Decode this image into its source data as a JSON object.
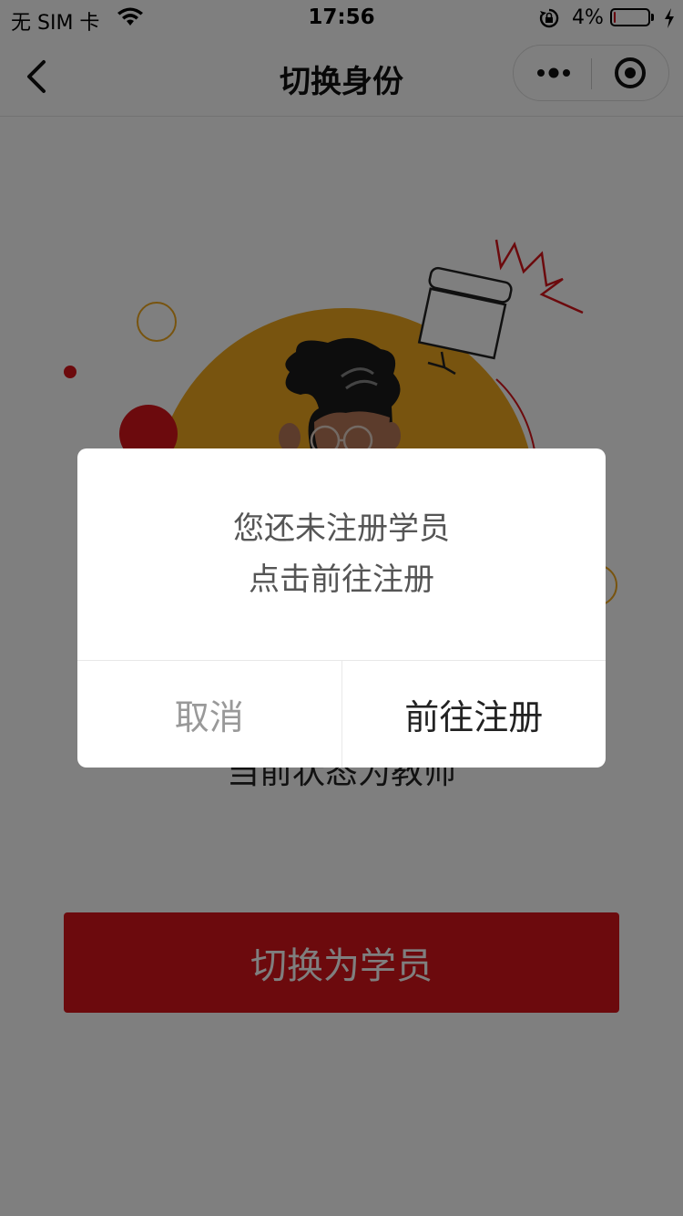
{
  "status_bar": {
    "carrier": "无 SIM 卡",
    "time": "17:56",
    "battery_percent": "4%",
    "battery_level": 0.04,
    "icons": [
      "wifi-icon",
      "orientation-lock-icon",
      "battery-icon",
      "charging-icon"
    ]
  },
  "nav": {
    "title": "切换身份",
    "back_icon": "chevron-left-icon",
    "more_icon": "more-dots-icon",
    "home_icon": "target-icon"
  },
  "main": {
    "status_text": "当前状态为教师",
    "switch_button_label": "切换为学员"
  },
  "modal": {
    "line1": "您还未注册学员",
    "line2": "点击前往注册",
    "cancel_label": "取消",
    "confirm_label": "前往注册"
  },
  "colors": {
    "primary_red": "#d8141a",
    "illustration_yellow": "#f0a91f",
    "mask": "rgba(0,0,0,0.5)"
  }
}
